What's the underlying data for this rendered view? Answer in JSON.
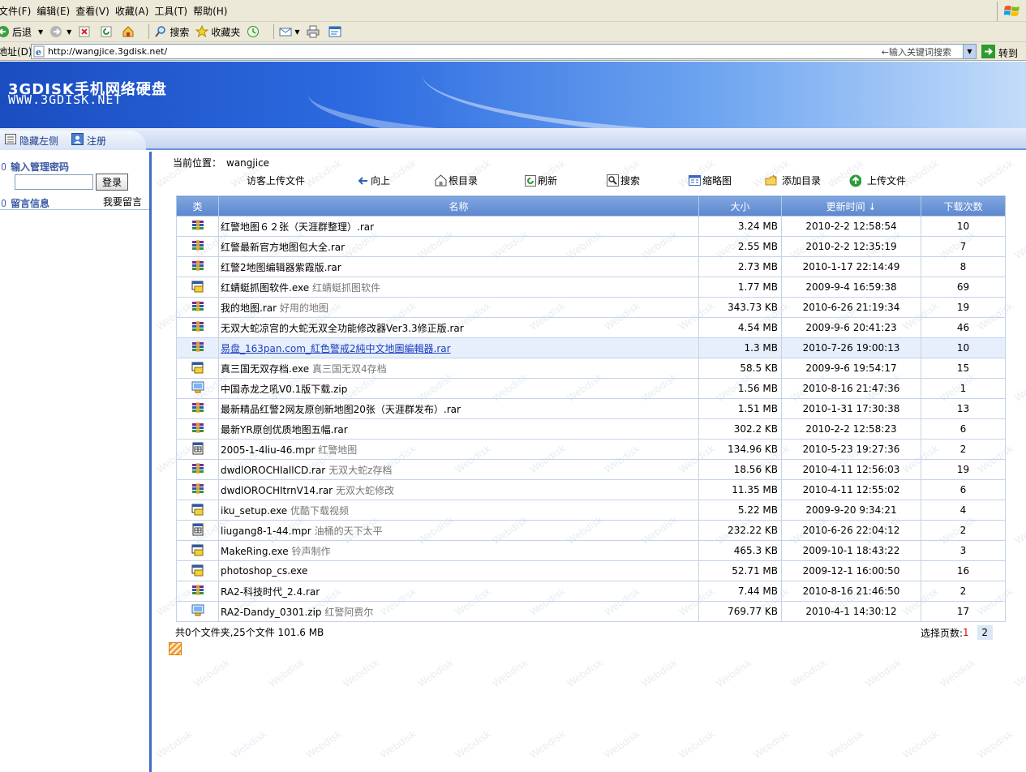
{
  "menu": [
    "文件(F)",
    "编辑(E)",
    "查看(V)",
    "收藏(A)",
    "工具(T)",
    "帮助(H)"
  ],
  "toolbar": {
    "back": "后退",
    "search": "搜索",
    "favorites": "收藏夹"
  },
  "address": {
    "label": "地址(D)",
    "url": "http://wangjice.3gdisk.net/",
    "hint": "←输入关键词搜索",
    "go": "转到"
  },
  "banner": {
    "title": "3GDISK手机网络硬盘",
    "subtitle": "WWW.3GDISK.NET"
  },
  "nav": {
    "hide_left": "隐藏左侧",
    "register": "注册"
  },
  "left": {
    "password_label": "输入管理密码",
    "login": "登录",
    "messages": "留言信息",
    "leave_message": "我要留言"
  },
  "breadcrumb": {
    "label": "当前位置：",
    "value": "wangjice"
  },
  "actions": {
    "guest_upload": "访客上传文件",
    "up": "向上",
    "root": "根目录",
    "refresh": "刷新",
    "search": "搜索",
    "thumbs": "缩略图",
    "add_dir": "添加目录",
    "upload": "上传文件"
  },
  "table": {
    "headers": {
      "type": "类",
      "name": "名称",
      "size": "大小",
      "time": "更新时间 ↓",
      "count": "下载次数"
    },
    "rows": [
      {
        "icon": "rar",
        "name": "红警地图６２张（天涯群整理）.rar",
        "desc": "",
        "size": "3.24 MB",
        "time": "2010-2-2 12:58:54",
        "count": "10"
      },
      {
        "icon": "rar",
        "name": "红警最新官方地图包大全.rar",
        "desc": "",
        "size": "2.55 MB",
        "time": "2010-2-2 12:35:19",
        "count": "7"
      },
      {
        "icon": "rar",
        "name": "红警2地图编辑器紫霞版.rar",
        "desc": "",
        "size": "2.73 MB",
        "time": "2010-1-17 22:14:49",
        "count": "8"
      },
      {
        "icon": "exe",
        "name": "红蜻蜓抓图软件.exe",
        "desc": "红蜻蜓抓图软件",
        "size": "1.77 MB",
        "time": "2009-9-4 16:59:38",
        "count": "69"
      },
      {
        "icon": "rar",
        "name": "我的地图.rar",
        "desc": "好用的地图",
        "size": "343.73 KB",
        "time": "2010-6-26 21:19:34",
        "count": "19"
      },
      {
        "icon": "rar",
        "name": "无双大蛇凉宫的大蛇无双全功能修改器Ver3.3修正版.rar",
        "desc": "",
        "size": "4.54 MB",
        "time": "2009-9-6 20:41:23",
        "count": "46"
      },
      {
        "icon": "rar",
        "name": "易盘_163pan.com_紅色警戒2純中文地圖編輯器.rar",
        "desc": "",
        "size": "1.3 MB",
        "time": "2010-7-26 19:00:13",
        "count": "10",
        "highlight": true
      },
      {
        "icon": "exe",
        "name": "真三国无双存档.exe",
        "desc": "真三国无双4存档",
        "size": "58.5 KB",
        "time": "2009-9-6 19:54:17",
        "count": "15"
      },
      {
        "icon": "zip",
        "name": "中国赤龙之吼V0.1版下载.zip",
        "desc": "",
        "size": "1.56 MB",
        "time": "2010-8-16 21:47:36",
        "count": "1"
      },
      {
        "icon": "rar",
        "name": "最新精品红警2网友原创新地图20张（天涯群发布）.rar",
        "desc": "",
        "size": "1.51 MB",
        "time": "2010-1-31 17:30:38",
        "count": "13"
      },
      {
        "icon": "rar",
        "name": "最新YR原创优质地图五幅.rar",
        "desc": "",
        "size": "302.2 KB",
        "time": "2010-2-2 12:58:23",
        "count": "6"
      },
      {
        "icon": "mpr",
        "name": "2005-1-4liu-46.mpr",
        "desc": "红警地图",
        "size": "134.96 KB",
        "time": "2010-5-23 19:27:36",
        "count": "2"
      },
      {
        "icon": "rar",
        "name": "dwdlOROCHIallCD.rar",
        "desc": "无双大蛇z存档",
        "size": "18.56 KB",
        "time": "2010-4-11 12:56:03",
        "count": "19"
      },
      {
        "icon": "rar",
        "name": "dwdlOROCHItrnV14.rar",
        "desc": "无双大蛇修改",
        "size": "11.35 MB",
        "time": "2010-4-11 12:55:02",
        "count": "6"
      },
      {
        "icon": "exe",
        "name": "iku_setup.exe",
        "desc": "优酷下载视频",
        "size": "5.22 MB",
        "time": "2009-9-20 9:34:21",
        "count": "4"
      },
      {
        "icon": "mpr",
        "name": "liugang8-1-44.mpr",
        "desc": "油桶的天下太平",
        "size": "232.22 KB",
        "time": "2010-6-26 22:04:12",
        "count": "2"
      },
      {
        "icon": "exe",
        "name": "MakeRing.exe",
        "desc": "铃声制作",
        "size": "465.3 KB",
        "time": "2009-10-1 18:43:22",
        "count": "3"
      },
      {
        "icon": "exe",
        "name": "photoshop_cs.exe",
        "desc": "",
        "size": "52.71 MB",
        "time": "2009-12-1 16:00:50",
        "count": "16"
      },
      {
        "icon": "rar",
        "name": "RA2-科技时代_2.4.rar",
        "desc": "",
        "size": "7.44 MB",
        "time": "2010-8-16 21:46:50",
        "count": "2"
      },
      {
        "icon": "zip",
        "name": "RA2-Dandy_0301.zip",
        "desc": "红警阿费尔",
        "size": "769.77 KB",
        "time": "2010-4-1 14:30:12",
        "count": "17"
      }
    ]
  },
  "summary": "共0个文件夹,25个文件  101.6 MB",
  "pager": {
    "label": "选择页数:",
    "current": "1",
    "next": "2"
  },
  "watermark": "Webdisk",
  "colors": {
    "accent": "#3e6cc9",
    "header": "#6a93d6",
    "highlight_link": "#1a3fbf",
    "rss": "#f29d38"
  }
}
